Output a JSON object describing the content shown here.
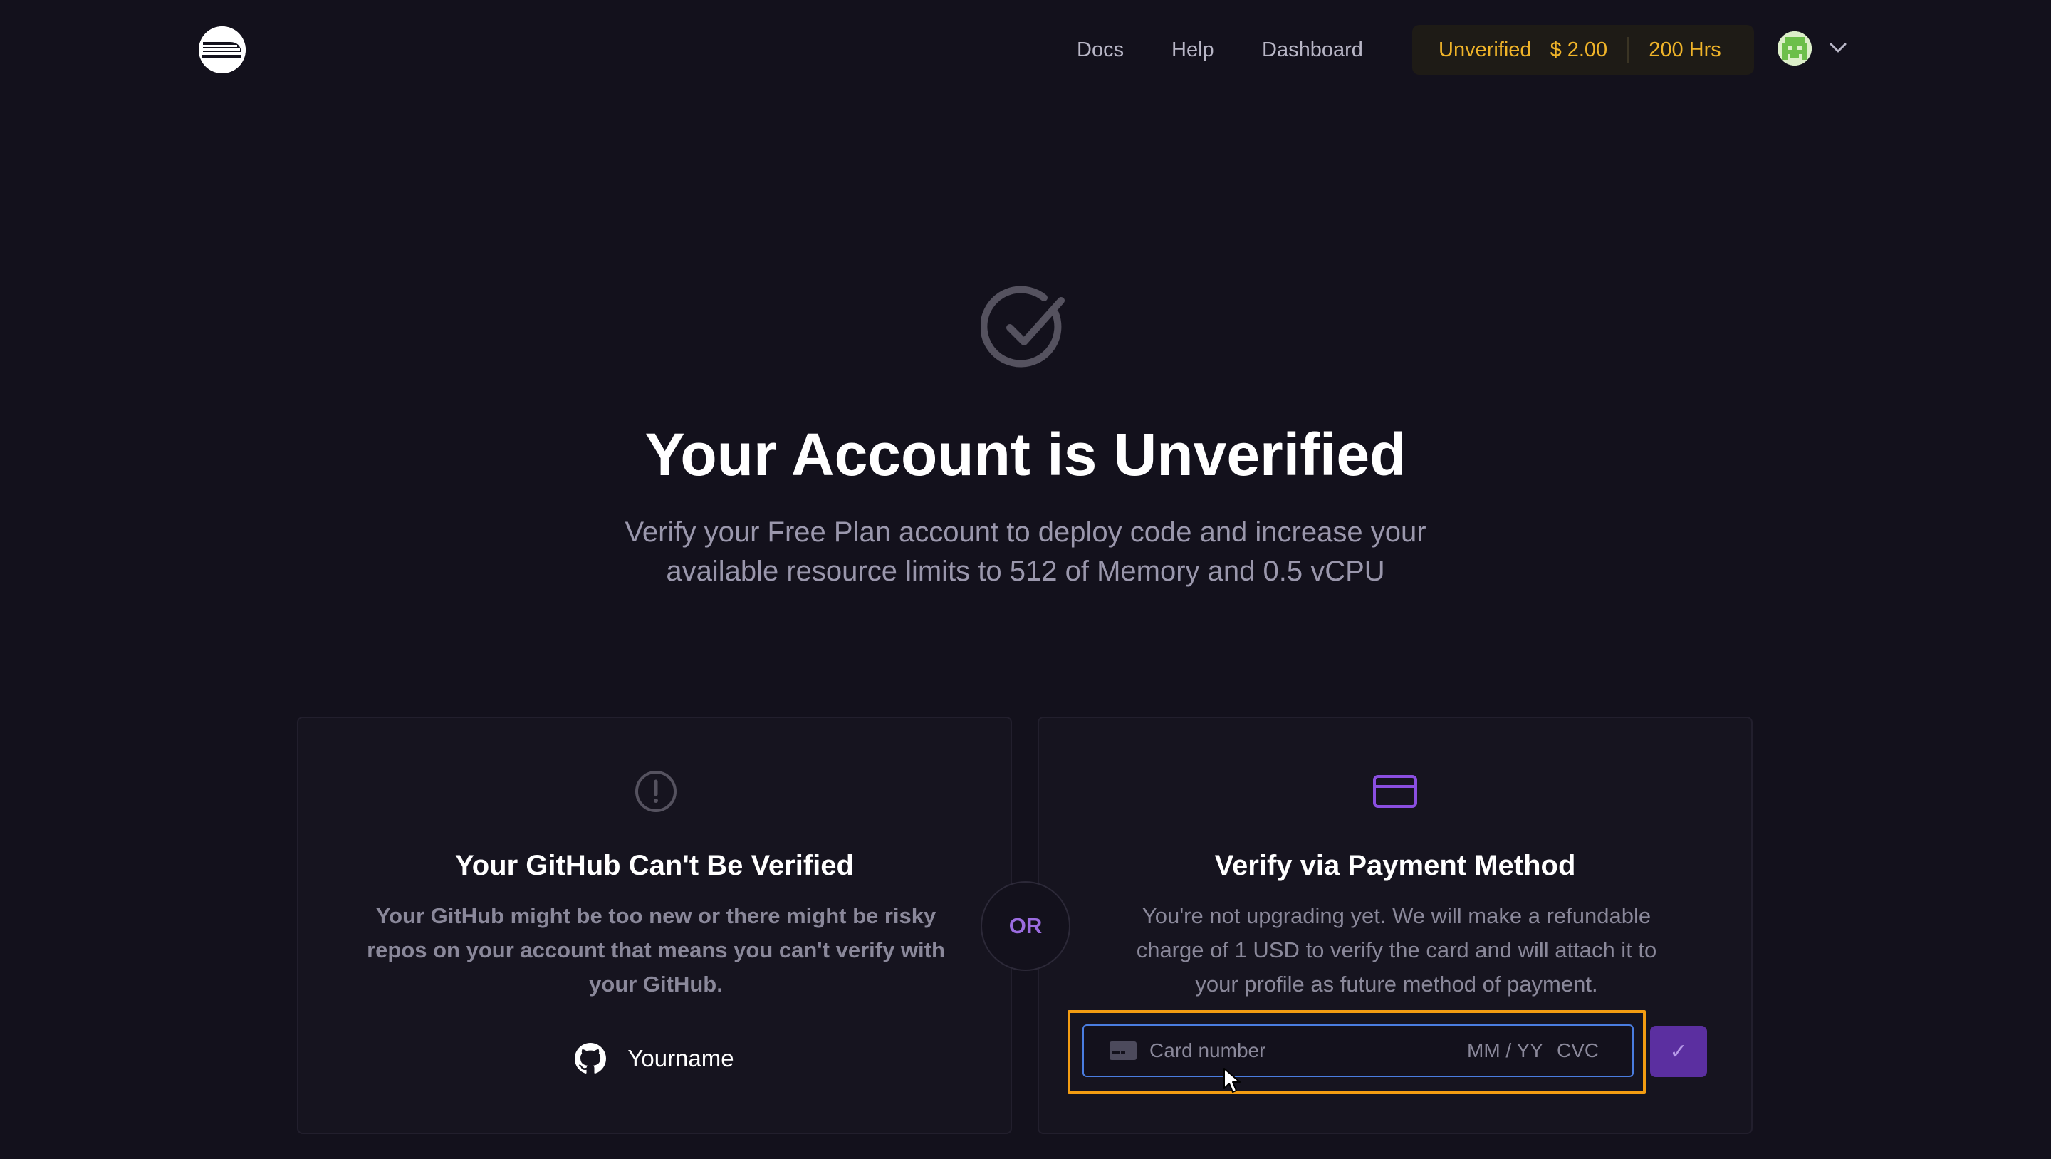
{
  "header": {
    "nav": [
      "Docs",
      "Help",
      "Dashboard"
    ],
    "status": {
      "label": "Unverified",
      "credit": "$ 2.00",
      "hours": "200 Hrs"
    }
  },
  "hero": {
    "title": "Your Account is Unverified",
    "subtitle_line1": "Verify your Free Plan account to deploy code and increase your",
    "subtitle_line2": "available resource limits to 512 of Memory and 0.5 vCPU"
  },
  "github_card": {
    "title": "Your GitHub Can't Be Verified",
    "desc_line1": "Your GitHub might be too new or there might be risky",
    "desc_line2": "repos on your account that means you can't verify with",
    "desc_line3": "your GitHub.",
    "username": "Yourname"
  },
  "separator": "OR",
  "payment_card": {
    "title": "Verify via Payment Method",
    "desc_line1": "You're not upgrading yet. We will make a refundable",
    "desc_line2": "charge of 1 USD to verify the card and will attach it to",
    "desc_line3": "your profile as future method of payment.",
    "card_number_placeholder": "Card number",
    "expiry_placeholder": "MM / YY",
    "cvc_placeholder": "CVC",
    "submit_symbol": "✓"
  },
  "colors": {
    "background": "#13111c",
    "accent_purple": "#9b6ce0",
    "status_yellow": "#f0b429",
    "highlight_orange": "#f39c12",
    "input_border_blue": "#4a7de0"
  },
  "icons": [
    "logo-icon",
    "avatar-icon",
    "chevron-down-icon",
    "check-circle-icon",
    "alert-circle-icon",
    "credit-card-icon",
    "github-icon",
    "card-chip-icon",
    "check-icon",
    "mouse-cursor-icon"
  ]
}
